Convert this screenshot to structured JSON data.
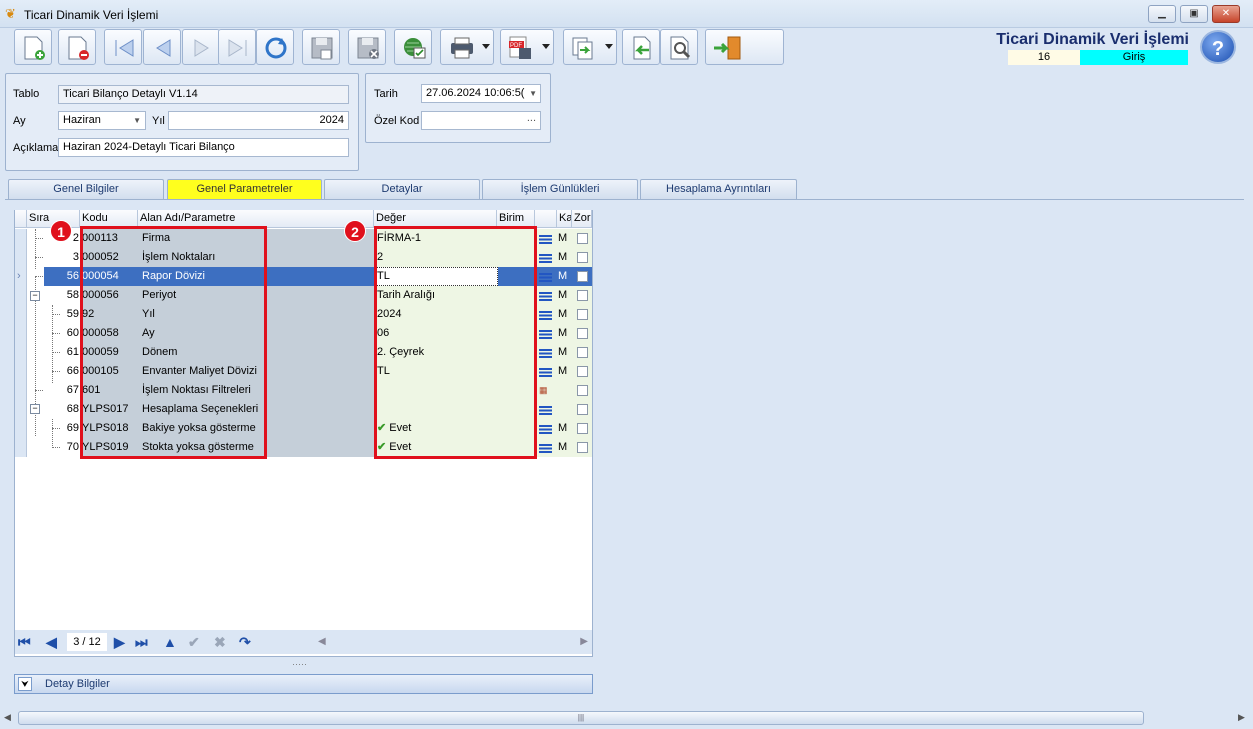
{
  "window": {
    "title": "Ticari Dinamik Veri İşlemi"
  },
  "header": {
    "title": "Ticari Dinamik Veri İşlemi",
    "record_no": "16",
    "status": "Giriş",
    "help": "?"
  },
  "form": {
    "tablo_label": "Tablo",
    "tablo_value": "Ticari Bilanço Detaylı V1.14",
    "ay_label": "Ay",
    "ay_value": "Haziran",
    "yil_label": "Yıl",
    "yil_value": "2024",
    "aciklama_label": "Açıklama",
    "aciklama_value": "Haziran 2024-Detaylı Ticari Bilanço",
    "tarih_label": "Tarih",
    "tarih_value": "27.06.2024 10:06:5(",
    "ozelkod_label": "Özel Kod",
    "ozelkod_value": "",
    "ozelkod_btn": "..."
  },
  "tabs": [
    "Genel Bilgiler",
    "Genel Parametreler",
    "Detaylar",
    "İşlem Günlükleri",
    "Hesaplama Ayrıntıları"
  ],
  "grid": {
    "columns": {
      "sira": "Sıra",
      "kodu": "Kodu",
      "alan": "Alan Adı/Parametre",
      "deger": "Değer",
      "birim": "Birim",
      "ka": "Ka",
      "zor": "Zor"
    },
    "rows": [
      {
        "sira": "2",
        "kodu": "000113",
        "alan": "Firma",
        "deger": "FİRMA-1",
        "m": "M"
      },
      {
        "sira": "3",
        "kodu": "000052",
        "alan": "İşlem Noktaları",
        "deger": "2",
        "m": "M"
      },
      {
        "sira": "56",
        "kodu": "000054",
        "alan": "Rapor Dövizi",
        "deger": "TL",
        "m": "M"
      },
      {
        "sira": "58",
        "kodu": "000056",
        "alan": "Periyot",
        "deger": "Tarih Aralığı",
        "m": "M"
      },
      {
        "sira": "59",
        "kodu": "92",
        "alan": "Yıl",
        "deger": "2024",
        "m": "M"
      },
      {
        "sira": "60",
        "kodu": "000058",
        "alan": "Ay",
        "deger": "06",
        "m": "M"
      },
      {
        "sira": "61",
        "kodu": "000059",
        "alan": "Dönem",
        "deger": "2. Çeyrek",
        "m": "M"
      },
      {
        "sira": "66",
        "kodu": "000105",
        "alan": "Envanter Maliyet Dövizi",
        "deger": "TL",
        "m": "M"
      },
      {
        "sira": "67",
        "kodu": "601",
        "alan": "İşlem Noktası Filtreleri",
        "deger": "",
        "m": ""
      },
      {
        "sira": "68",
        "kodu": "YLPS017",
        "alan": "Hesaplama Seçenekleri",
        "deger": "",
        "m": ""
      },
      {
        "sira": "69",
        "kodu": "YLPS018",
        "alan": "Bakiye yoksa gösterme",
        "deger": "Evet",
        "m": "M"
      },
      {
        "sira": "70",
        "kodu": "YLPS019",
        "alan": "Stokta yoksa gösterme",
        "deger": "Evet",
        "m": "M"
      }
    ],
    "pager": "3 / 12"
  },
  "badges": [
    "1",
    "2"
  ],
  "detay": {
    "label": "Detay Bilgiler"
  },
  "colors": {
    "accent": "#3d6fc1",
    "highlight_tab": "#ffff1e",
    "status_bg": "#00ffff",
    "annotation": "#e0101c"
  }
}
